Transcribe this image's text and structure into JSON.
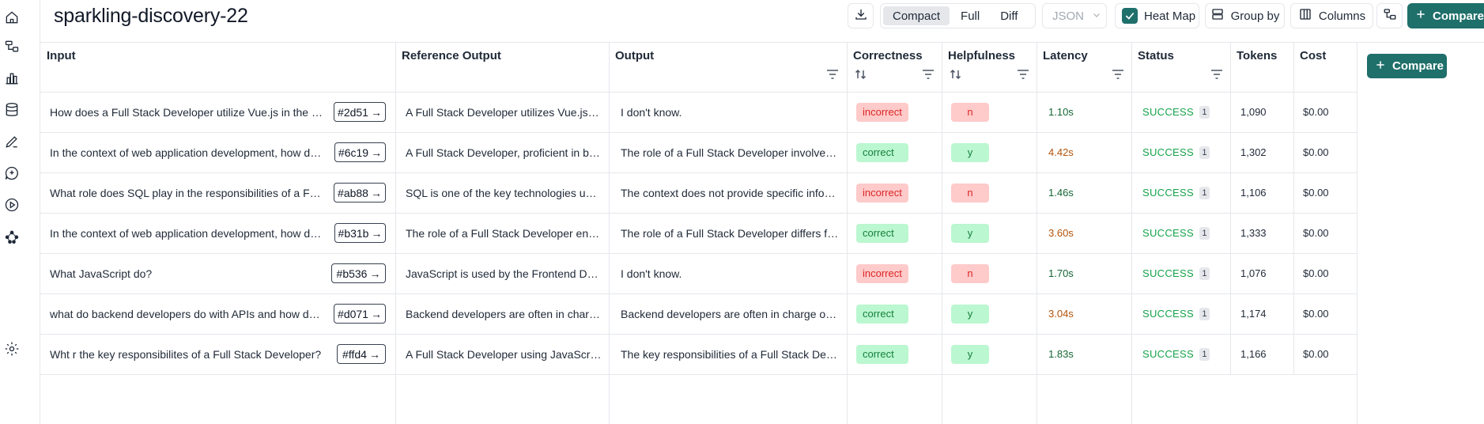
{
  "experiment": {
    "title": "sparkling-discovery-22"
  },
  "toolbar": {
    "view_modes": [
      "Compact",
      "Full",
      "Diff"
    ],
    "active_view": "Compact",
    "format_select": "JSON",
    "heat_map_label": "Heat Map",
    "heat_map_checked": true,
    "group_by_label": "Group by",
    "columns_label": "Columns",
    "compare_label": "Compare"
  },
  "table": {
    "columns": [
      "Input",
      "Reference Output",
      "Output",
      "Correctness",
      "Helpfulness",
      "Latency",
      "Status",
      "Tokens",
      "Cost"
    ],
    "compare_label": "Compare",
    "rows": [
      {
        "input": "How does a Full Stack Developer utilize Vue.js in the development process?",
        "ref": "#2d51",
        "reference_output": "A Full Stack Developer utilizes Vue.js in the development process...",
        "output": "I don't know.",
        "correctness": "incorrect",
        "helpfulness": "n",
        "latency": "1.10s",
        "latency_level": "green",
        "status": "SUCCESS",
        "status_count": "1",
        "tokens": "1,090",
        "cost": "$0.00"
      },
      {
        "input": "In the context of web application development, how does a Full Stack Developer...",
        "ref": "#6c19",
        "reference_output": "A Full Stack Developer, proficient in both frontend and backend...",
        "output": "The role of a Full Stack Developer involves working on both...",
        "correctness": "correct",
        "helpfulness": "y",
        "latency": "4.42s",
        "latency_level": "orange",
        "status": "SUCCESS",
        "status_count": "1",
        "tokens": "1,302",
        "cost": "$0.00"
      },
      {
        "input": "What role does SQL play in the responsibilities of a Full Stack Developer?",
        "ref": "#ab88",
        "reference_output": "SQL is one of the key technologies used by a Full Stack Developer...",
        "output": "The context does not provide specific information about SQL...",
        "correctness": "incorrect",
        "helpfulness": "n",
        "latency": "1.46s",
        "latency_level": "green",
        "status": "SUCCESS",
        "status_count": "1",
        "tokens": "1,106",
        "cost": "$0.00"
      },
      {
        "input": "In the context of web application development, how do the roles differ...",
        "ref": "#b31b",
        "reference_output": "The role of a Full Stack Developer encompasses both frontend...",
        "output": "The role of a Full Stack Developer differs from specialized roles...",
        "correctness": "correct",
        "helpfulness": "y",
        "latency": "3.60s",
        "latency_level": "orange",
        "status": "SUCCESS",
        "status_count": "1",
        "tokens": "1,333",
        "cost": "$0.00"
      },
      {
        "input": "What JavaScript do?",
        "ref": "#b536",
        "reference_output": "JavaScript is used by the Frontend Developer to add interactivity...",
        "output": "I don't know.",
        "correctness": "incorrect",
        "helpfulness": "n",
        "latency": "1.70s",
        "latency_level": "green",
        "status": "SUCCESS",
        "status_count": "1",
        "tokens": "1,076",
        "cost": "$0.00"
      },
      {
        "input": "what do backend developers do with APIs and how do they work?",
        "ref": "#d071",
        "reference_output": "Backend developers are often in charge of designing APIs...",
        "output": "Backend developers are often in charge of building and maintaining APIs...",
        "correctness": "correct",
        "helpfulness": "y",
        "latency": "3.04s",
        "latency_level": "orange",
        "status": "SUCCESS",
        "status_count": "1",
        "tokens": "1,174",
        "cost": "$0.00"
      },
      {
        "input": "Wht r the key responsibilites of a Full Stack Developer?",
        "ref": "#ffd4",
        "reference_output": "A Full Stack Developer using JavaScript frameworks is responsible...",
        "output": "The key responsibilities of a Full Stack Developer include...",
        "correctness": "correct",
        "helpfulness": "y",
        "latency": "1.83s",
        "latency_level": "green",
        "status": "SUCCESS",
        "status_count": "1",
        "tokens": "1,166",
        "cost": "$0.00"
      }
    ]
  },
  "sidebar": {
    "icons": [
      "home-icon",
      "tracing-icon",
      "charts-icon",
      "datasets-icon",
      "annotations-icon",
      "prompts-icon",
      "playground-icon",
      "graph-icon",
      "settings-icon"
    ]
  },
  "colors": {
    "accent": "#1f6f6b",
    "incorrect_bg": "#fecaca",
    "correct_bg": "#bbf7d0",
    "status_success": "#16a34a",
    "latency_slow": "#b45309"
  }
}
